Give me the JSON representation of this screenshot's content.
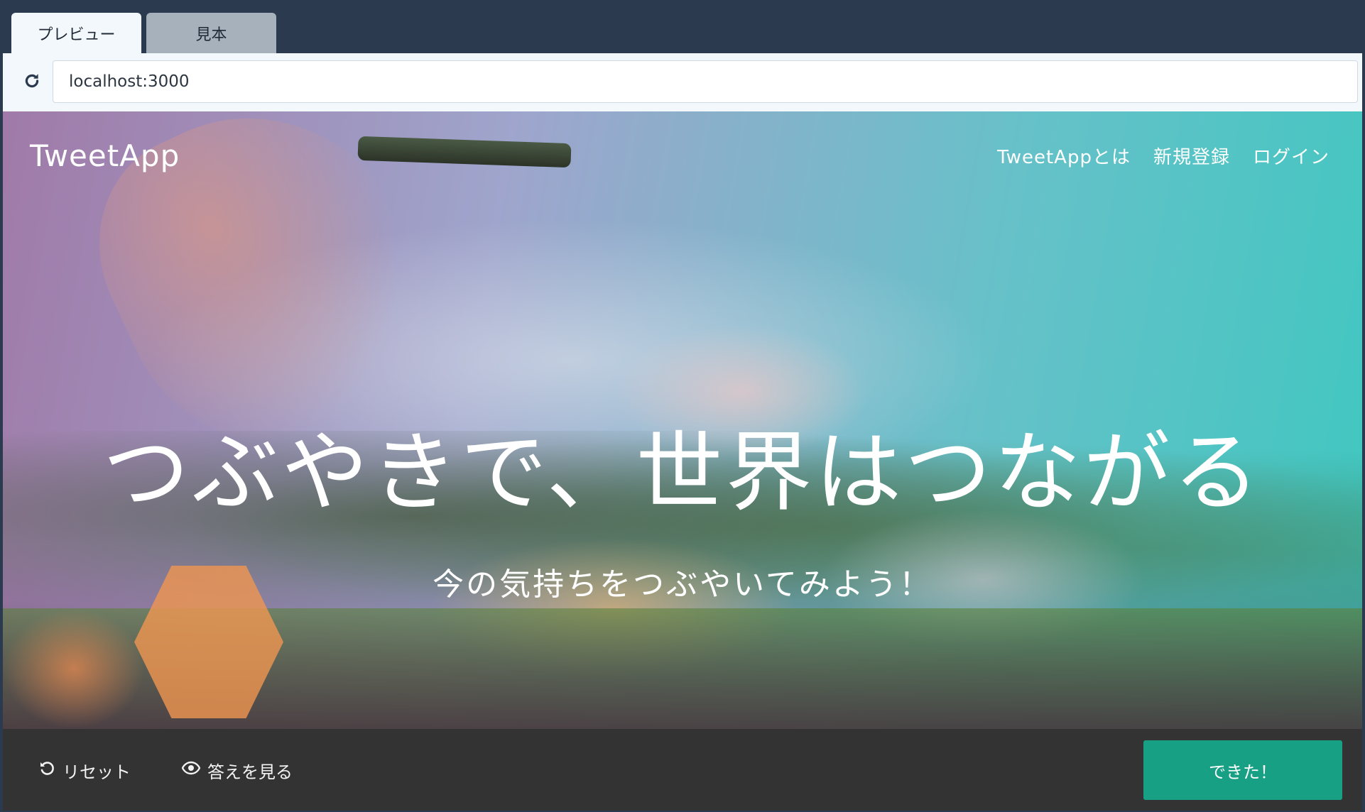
{
  "tabs": [
    {
      "label": "プレビュー",
      "active": true
    },
    {
      "label": "見本",
      "active": false
    }
  ],
  "address_bar": {
    "url": "localhost:3000"
  },
  "site": {
    "brand": "TweetApp",
    "nav": [
      "TweetAppとは",
      "新規登録",
      "ログイン"
    ],
    "hero_title": "つぶやきで、世界はつながる",
    "hero_subtitle": "今の気持ちをつぶやいてみよう！"
  },
  "toolbar": {
    "reset_label": "リセット",
    "answer_label": "答えを見る",
    "done_label": "できた！"
  },
  "colors": {
    "chrome_bg": "#2b3a4e",
    "address_bg": "#f3f8fc",
    "toolbar_bg": "#333333",
    "done_button": "#17a083"
  },
  "icons": [
    "reload-icon",
    "reset-icon",
    "eye-icon"
  ]
}
